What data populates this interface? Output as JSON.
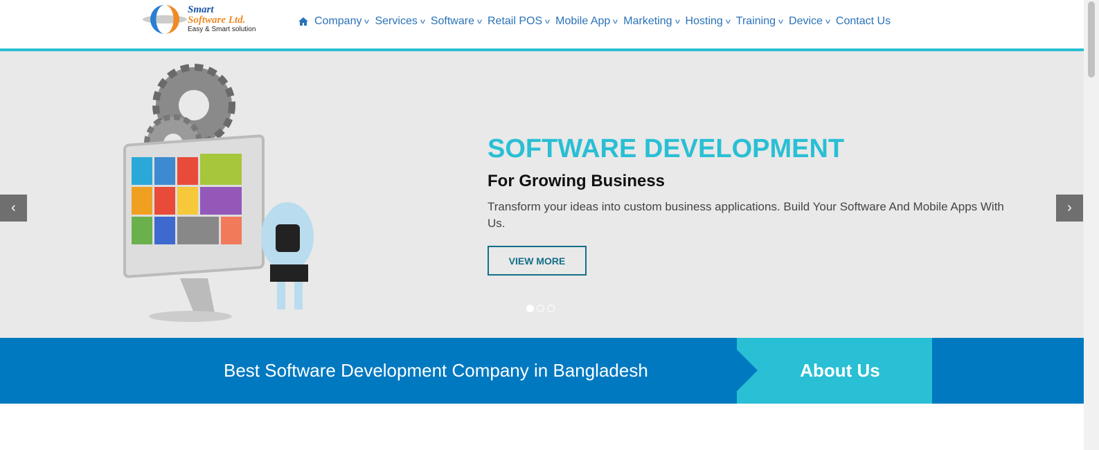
{
  "logo": {
    "line1": "Smart",
    "line2": "Software Ltd.",
    "tagline": "Easy & Smart solution"
  },
  "nav": {
    "home_icon": "home-icon",
    "items": [
      "Company",
      "Services",
      "Software",
      "Retail POS",
      "Mobile App",
      "Marketing",
      "Hosting",
      "Training",
      "Device",
      "Contact Us"
    ]
  },
  "hero": {
    "title": "SOFTWARE DEVELOPMENT",
    "subtitle": "For Growing Business",
    "description": "Transform your ideas into custom business applications. Build Your Software And Mobile Apps With Us.",
    "button": "VIEW MORE",
    "prev": "‹",
    "next": "›",
    "slides": 3,
    "active_slide": 1
  },
  "band": {
    "text": "Best Software Development Company in Bangladesh",
    "about": "About Us"
  },
  "colors": {
    "accent": "#29bfd4",
    "nav": "#2a72b8",
    "band": "#0079c1"
  }
}
